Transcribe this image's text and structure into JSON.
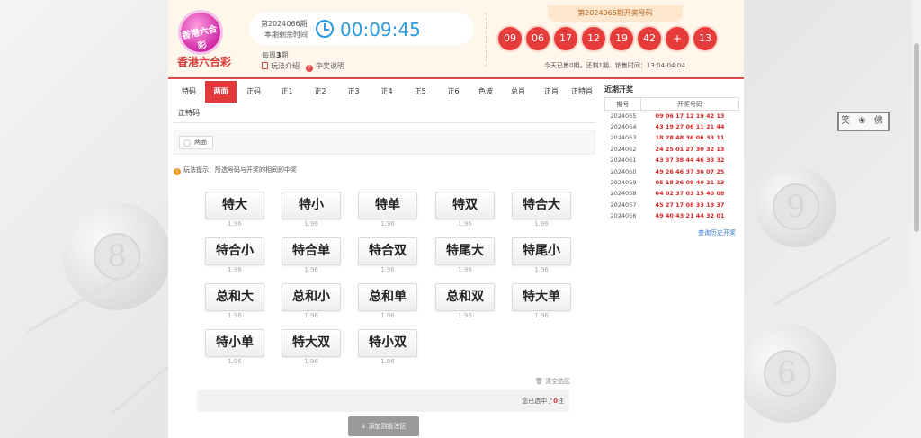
{
  "header": {
    "brand": "香港六合彩",
    "logo_text": "香港六合彩",
    "issue_title": "第2024066期",
    "issue_sub": "本期剩余时间",
    "countdown": "00:09:45",
    "weekly_prefix": "每周",
    "weekly_count": "3",
    "weekly_suffix": "期",
    "rules_link": "玩法介绍",
    "prize_link": "中奖说明",
    "last_draw_title": "第2024065期开奖号码",
    "last_draw_numbers": [
      "09",
      "06",
      "17",
      "12",
      "19",
      "42",
      "+",
      "13"
    ],
    "sales_info": "今天已售0期，还剩1期　销售时间：13:04-04:04"
  },
  "tabs": [
    "特码",
    "两面",
    "正码",
    "正1",
    "正2",
    "正3",
    "正4",
    "正5",
    "正6",
    "色波",
    "总肖",
    "正肖",
    "正特肖",
    "正特码"
  ],
  "active_tab": "两面",
  "subtab": "两面",
  "tip": "玩法提示：所选号码与开奖的相同即中奖",
  "bets": [
    {
      "label": "特大",
      "odds": "1.96"
    },
    {
      "label": "特小",
      "odds": "1.96"
    },
    {
      "label": "特单",
      "odds": "1.96"
    },
    {
      "label": "特双",
      "odds": "1.96"
    },
    {
      "label": "特合大",
      "odds": "1.96"
    },
    {
      "label": "特合小",
      "odds": "1.96"
    },
    {
      "label": "特合单",
      "odds": "1.96"
    },
    {
      "label": "特合双",
      "odds": "1.96"
    },
    {
      "label": "特尾大",
      "odds": "1.96"
    },
    {
      "label": "特尾小",
      "odds": "1.96"
    },
    {
      "label": "总和大",
      "odds": "1.96"
    },
    {
      "label": "总和小",
      "odds": "1.96"
    },
    {
      "label": "总和单",
      "odds": "1.96"
    },
    {
      "label": "总和双",
      "odds": "1.96"
    },
    {
      "label": "特大单",
      "odds": "1.96"
    },
    {
      "label": "特小单",
      "odds": "1.96"
    },
    {
      "label": "特大双",
      "odds": "1.96"
    },
    {
      "label": "特小双",
      "odds": "1.96"
    }
  ],
  "clear_label": "清空选区",
  "selected_prefix": "您已选中了",
  "selected_count": "0",
  "selected_suffix": "注",
  "add_button": "添加到投注区",
  "recent": {
    "title": "近期开奖",
    "col_period": "期号",
    "col_numbers": "开奖号码",
    "rows": [
      {
        "period": "2024065",
        "numbers": "09 06 17 12 19 42 13"
      },
      {
        "period": "2024064",
        "numbers": "43 19 27 06 11 21 44"
      },
      {
        "period": "2024063",
        "numbers": "18 28 48 36 06 33 11"
      },
      {
        "period": "2024062",
        "numbers": "24 25 01 27 30 32 13"
      },
      {
        "period": "2024061",
        "numbers": "43 37 38 44 46 33 32"
      },
      {
        "period": "2024060",
        "numbers": "49 26 46 37 30 07 25"
      },
      {
        "period": "2024059",
        "numbers": "05 18 36 09 40 21 13"
      },
      {
        "period": "2024058",
        "numbers": "04 02 37 03 15 40 08"
      },
      {
        "period": "2024057",
        "numbers": "45 27 17 08 33 19 37"
      },
      {
        "period": "2024056",
        "numbers": "49 40 43 21 44 32 01"
      }
    ],
    "history_link": "查询历史开奖"
  },
  "background": {
    "sign_text": "笑 ❀ 佛",
    "ball_numbers": [
      "8",
      "9",
      "6"
    ]
  },
  "colors": {
    "accent": "#e03a3a",
    "countdown": "#2a9ae0",
    "header_bg": "#fff7ec"
  }
}
